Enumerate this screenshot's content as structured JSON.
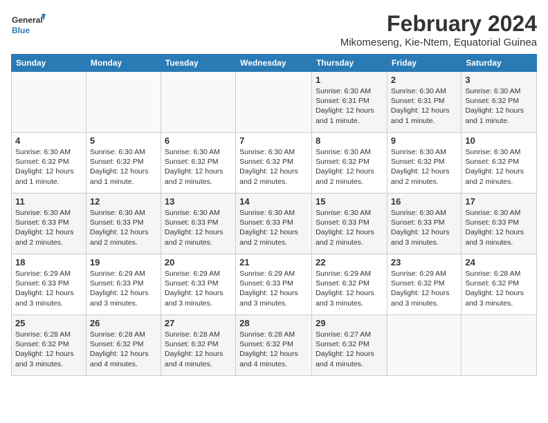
{
  "header": {
    "logo_text_general": "General",
    "logo_text_blue": "Blue",
    "month_year": "February 2024",
    "subtitle": "Mikomeseng, Kie-Ntem, Equatorial Guinea"
  },
  "days_of_week": [
    "Sunday",
    "Monday",
    "Tuesday",
    "Wednesday",
    "Thursday",
    "Friday",
    "Saturday"
  ],
  "weeks": [
    [
      {
        "day": "",
        "info": ""
      },
      {
        "day": "",
        "info": ""
      },
      {
        "day": "",
        "info": ""
      },
      {
        "day": "",
        "info": ""
      },
      {
        "day": "1",
        "info": "Sunrise: 6:30 AM\nSunset: 6:31 PM\nDaylight: 12 hours\nand 1 minute."
      },
      {
        "day": "2",
        "info": "Sunrise: 6:30 AM\nSunset: 6:31 PM\nDaylight: 12 hours\nand 1 minute."
      },
      {
        "day": "3",
        "info": "Sunrise: 6:30 AM\nSunset: 6:32 PM\nDaylight: 12 hours\nand 1 minute."
      }
    ],
    [
      {
        "day": "4",
        "info": "Sunrise: 6:30 AM\nSunset: 6:32 PM\nDaylight: 12 hours\nand 1 minute."
      },
      {
        "day": "5",
        "info": "Sunrise: 6:30 AM\nSunset: 6:32 PM\nDaylight: 12 hours\nand 1 minute."
      },
      {
        "day": "6",
        "info": "Sunrise: 6:30 AM\nSunset: 6:32 PM\nDaylight: 12 hours\nand 2 minutes."
      },
      {
        "day": "7",
        "info": "Sunrise: 6:30 AM\nSunset: 6:32 PM\nDaylight: 12 hours\nand 2 minutes."
      },
      {
        "day": "8",
        "info": "Sunrise: 6:30 AM\nSunset: 6:32 PM\nDaylight: 12 hours\nand 2 minutes."
      },
      {
        "day": "9",
        "info": "Sunrise: 6:30 AM\nSunset: 6:32 PM\nDaylight: 12 hours\nand 2 minutes."
      },
      {
        "day": "10",
        "info": "Sunrise: 6:30 AM\nSunset: 6:32 PM\nDaylight: 12 hours\nand 2 minutes."
      }
    ],
    [
      {
        "day": "11",
        "info": "Sunrise: 6:30 AM\nSunset: 6:33 PM\nDaylight: 12 hours\nand 2 minutes."
      },
      {
        "day": "12",
        "info": "Sunrise: 6:30 AM\nSunset: 6:33 PM\nDaylight: 12 hours\nand 2 minutes."
      },
      {
        "day": "13",
        "info": "Sunrise: 6:30 AM\nSunset: 6:33 PM\nDaylight: 12 hours\nand 2 minutes."
      },
      {
        "day": "14",
        "info": "Sunrise: 6:30 AM\nSunset: 6:33 PM\nDaylight: 12 hours\nand 2 minutes."
      },
      {
        "day": "15",
        "info": "Sunrise: 6:30 AM\nSunset: 6:33 PM\nDaylight: 12 hours\nand 2 minutes."
      },
      {
        "day": "16",
        "info": "Sunrise: 6:30 AM\nSunset: 6:33 PM\nDaylight: 12 hours\nand 3 minutes."
      },
      {
        "day": "17",
        "info": "Sunrise: 6:30 AM\nSunset: 6:33 PM\nDaylight: 12 hours\nand 3 minutes."
      }
    ],
    [
      {
        "day": "18",
        "info": "Sunrise: 6:29 AM\nSunset: 6:33 PM\nDaylight: 12 hours\nand 3 minutes."
      },
      {
        "day": "19",
        "info": "Sunrise: 6:29 AM\nSunset: 6:33 PM\nDaylight: 12 hours\nand 3 minutes."
      },
      {
        "day": "20",
        "info": "Sunrise: 6:29 AM\nSunset: 6:33 PM\nDaylight: 12 hours\nand 3 minutes."
      },
      {
        "day": "21",
        "info": "Sunrise: 6:29 AM\nSunset: 6:33 PM\nDaylight: 12 hours\nand 3 minutes."
      },
      {
        "day": "22",
        "info": "Sunrise: 6:29 AM\nSunset: 6:32 PM\nDaylight: 12 hours\nand 3 minutes."
      },
      {
        "day": "23",
        "info": "Sunrise: 6:29 AM\nSunset: 6:32 PM\nDaylight: 12 hours\nand 3 minutes."
      },
      {
        "day": "24",
        "info": "Sunrise: 6:28 AM\nSunset: 6:32 PM\nDaylight: 12 hours\nand 3 minutes."
      }
    ],
    [
      {
        "day": "25",
        "info": "Sunrise: 6:28 AM\nSunset: 6:32 PM\nDaylight: 12 hours\nand 3 minutes."
      },
      {
        "day": "26",
        "info": "Sunrise: 6:28 AM\nSunset: 6:32 PM\nDaylight: 12 hours\nand 4 minutes."
      },
      {
        "day": "27",
        "info": "Sunrise: 6:28 AM\nSunset: 6:32 PM\nDaylight: 12 hours\nand 4 minutes."
      },
      {
        "day": "28",
        "info": "Sunrise: 6:28 AM\nSunset: 6:32 PM\nDaylight: 12 hours\nand 4 minutes."
      },
      {
        "day": "29",
        "info": "Sunrise: 6:27 AM\nSunset: 6:32 PM\nDaylight: 12 hours\nand 4 minutes."
      },
      {
        "day": "",
        "info": ""
      },
      {
        "day": "",
        "info": ""
      }
    ]
  ]
}
